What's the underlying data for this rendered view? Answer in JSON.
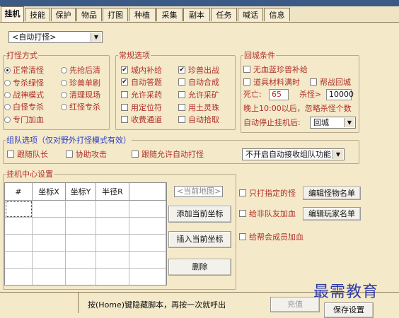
{
  "tabs": [
    "挂机",
    "技能",
    "保护",
    "物品",
    "打图",
    "种植",
    "采集",
    "副本",
    "任务",
    "喊话",
    "信息"
  ],
  "mode_select": "<自动打怪>",
  "attack": {
    "title": "打怪方式",
    "options": [
      {
        "label": "正常清怪",
        "checked": true
      },
      {
        "label": "先抢后清",
        "checked": false
      },
      {
        "label": "专杀绿怪",
        "checked": false
      },
      {
        "label": "珍兽单刷",
        "checked": false
      },
      {
        "label": "战神模式",
        "checked": false
      },
      {
        "label": "清理现场",
        "checked": false
      },
      {
        "label": "白怪专杀",
        "checked": false
      },
      {
        "label": "红怪专杀",
        "checked": false
      },
      {
        "label": "专门加血",
        "checked": false
      }
    ]
  },
  "general": {
    "title": "常规选项",
    "options": [
      {
        "label": "城内补给",
        "checked": true
      },
      {
        "label": "珍兽出战",
        "checked": true
      },
      {
        "label": "自动答题",
        "checked": true
      },
      {
        "label": "自动合成",
        "checked": false
      },
      {
        "label": "允许采药",
        "checked": false
      },
      {
        "label": "允许采矿",
        "checked": false
      },
      {
        "label": "用定位符",
        "checked": false
      },
      {
        "label": "用土灵珠",
        "checked": false
      },
      {
        "label": "收费通道",
        "checked": false
      },
      {
        "label": "自动拾取",
        "checked": false
      }
    ]
  },
  "return": {
    "title": "回城条件",
    "opt1": "无血蓝珍兽补给",
    "opt2": "道具材料满时",
    "opt3": "帮战回城",
    "death_label": "死亡:",
    "death_value": "65",
    "kill_label": "杀怪>",
    "kill_value": "10000",
    "note": "晚上10:00以后，忽略杀怪个数",
    "auto_stop_label": "自动停止挂机后:",
    "auto_stop_value": "回城"
  },
  "team": {
    "title": "组队选项（仅对野外打怪模式有效）",
    "follow_leader": "跟随队长",
    "assist_attack": "协助攻击",
    "follow_auto": "跟随允许自动打怪",
    "team_select": "不开启自动接收组队功能"
  },
  "center": {
    "title": "挂机中心设置",
    "headers": [
      "#",
      "坐标X",
      "坐标Y",
      "半径R"
    ],
    "current_map": "<当前地图>",
    "add_btn": "添加当前坐标",
    "insert_btn": "插入当前坐标",
    "delete_btn": "删除",
    "only_specified": "只打指定的怪",
    "edit_monster": "编辑怪物名单",
    "heal_non_team": "给非队友加血",
    "edit_player": "编辑玩家名单",
    "heal_guild": "给帮会成员加血"
  },
  "bottom": {
    "hint": "按(Home)键隐藏脚本，再按一次就呼出",
    "charge": "充值",
    "settings": "保存设置"
  },
  "watermark": "最需教育"
}
